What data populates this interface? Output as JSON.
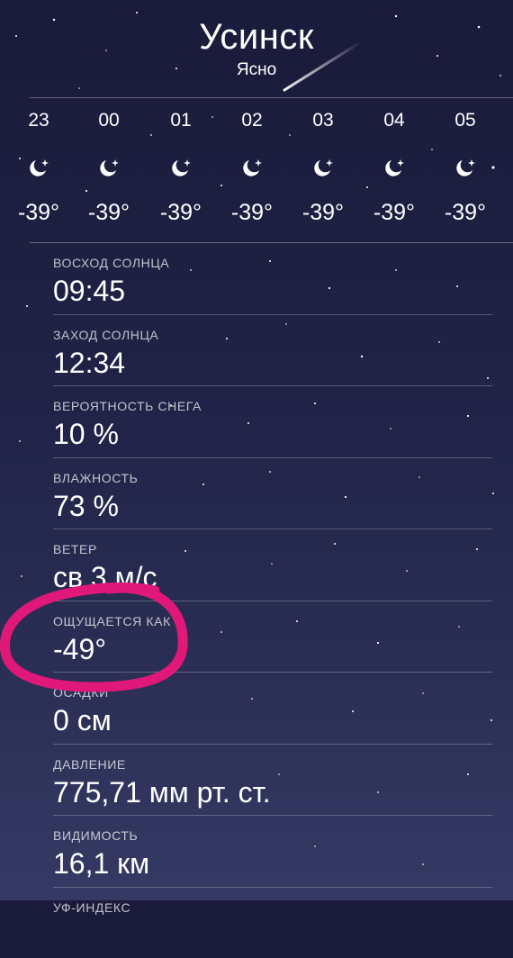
{
  "header": {
    "city": "Усинск",
    "condition": "Ясно"
  },
  "hourly": [
    {
      "time": "23",
      "icon": "moon-stars-icon",
      "temp": "-39°"
    },
    {
      "time": "00",
      "icon": "moon-stars-icon",
      "temp": "-39°"
    },
    {
      "time": "01",
      "icon": "moon-stars-icon",
      "temp": "-39°"
    },
    {
      "time": "02",
      "icon": "moon-stars-icon",
      "temp": "-39°"
    },
    {
      "time": "03",
      "icon": "moon-stars-icon",
      "temp": "-39°"
    },
    {
      "time": "04",
      "icon": "moon-stars-icon",
      "temp": "-39°"
    },
    {
      "time": "05",
      "icon": "moon-stars-icon",
      "temp": "-39°"
    }
  ],
  "details": [
    {
      "label": "ВОСХОД СОЛНЦА",
      "value": "09:45"
    },
    {
      "label": "ЗАХОД СОЛНЦА",
      "value": "12:34"
    },
    {
      "label": "ВЕРОЯТНОСТЬ СНЕГА",
      "value": "10 %"
    },
    {
      "label": "ВЛАЖНОСТЬ",
      "value": "73 %"
    },
    {
      "label": "ВЕТЕР",
      "value": "св 3 м/с"
    },
    {
      "label": "ОЩУЩАЕТСЯ КАК",
      "value": "-49°"
    },
    {
      "label": "ОСАДКИ",
      "value": "0 см"
    },
    {
      "label": "ДАВЛЕНИЕ",
      "value": "775,71 мм рт. ст."
    },
    {
      "label": "ВИДИМОСТЬ",
      "value": "16,1 км"
    },
    {
      "label": "УФ-ИНДЕКС",
      "value": ""
    }
  ],
  "colors": {
    "background_top": "#1a1b3a",
    "background_bottom": "#343a63",
    "annotation_circle": "#e0187a"
  }
}
